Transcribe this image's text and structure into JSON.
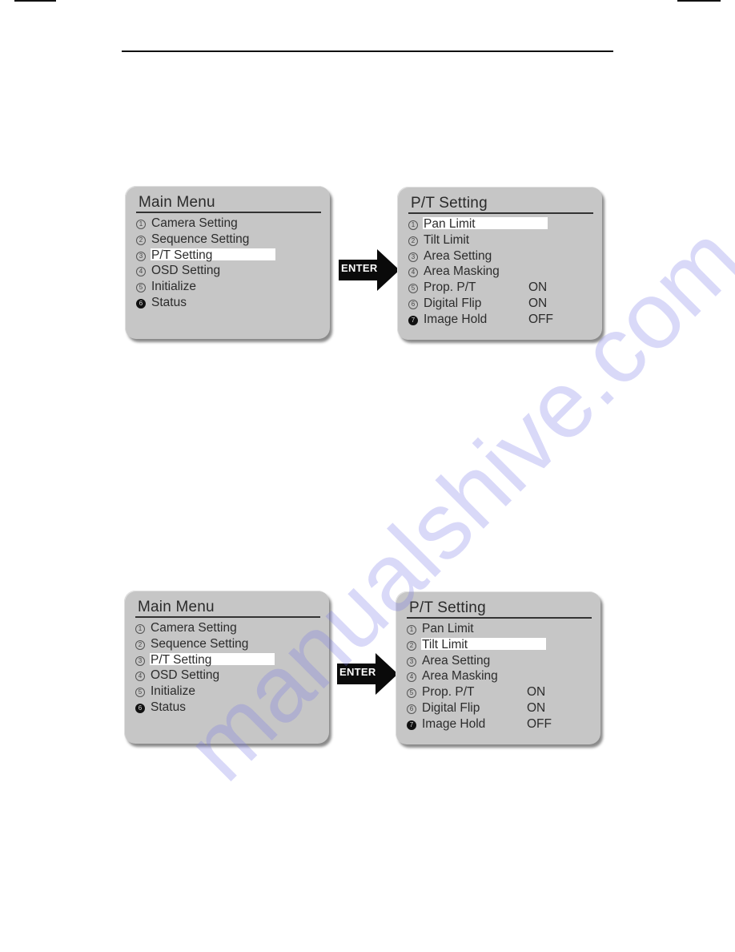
{
  "diagrams": [
    {
      "main_menu": {
        "title": "Main Menu",
        "items": [
          {
            "num": "1",
            "label": "Camera Setting",
            "filled": false
          },
          {
            "num": "2",
            "label": "Sequence Setting",
            "filled": false
          },
          {
            "num": "3",
            "label": "P/T Setting",
            "filled": false,
            "selected": true
          },
          {
            "num": "4",
            "label": "OSD Setting",
            "filled": false
          },
          {
            "num": "5",
            "label": "Initialize",
            "filled": false
          },
          {
            "num": "6",
            "label": "Status",
            "filled": true
          }
        ]
      },
      "arrow_label": "ENTER",
      "submenu": {
        "title": "P/T Setting",
        "items": [
          {
            "num": "1",
            "label": "Pan Limit",
            "value": "",
            "selected": true
          },
          {
            "num": "2",
            "label": "Tilt Limit",
            "value": ""
          },
          {
            "num": "3",
            "label": "Area Setting",
            "value": ""
          },
          {
            "num": "4",
            "label": "Area Masking",
            "value": ""
          },
          {
            "num": "5",
            "label": "Prop. P/T",
            "value": "ON"
          },
          {
            "num": "6",
            "label": "Digital Flip",
            "value": "ON"
          },
          {
            "num": "7",
            "label": "Image Hold",
            "value": "OFF",
            "filled": true
          }
        ]
      }
    },
    {
      "main_menu": {
        "title": "Main Menu",
        "items": [
          {
            "num": "1",
            "label": "Camera Setting",
            "filled": false
          },
          {
            "num": "2",
            "label": "Sequence Setting",
            "filled": false
          },
          {
            "num": "3",
            "label": "P/T Setting",
            "filled": false,
            "selected": true
          },
          {
            "num": "4",
            "label": "OSD Setting",
            "filled": false
          },
          {
            "num": "5",
            "label": "Initialize",
            "filled": false
          },
          {
            "num": "6",
            "label": "Status",
            "filled": true
          }
        ]
      },
      "arrow_label": "ENTER",
      "submenu": {
        "title": "P/T Setting",
        "items": [
          {
            "num": "1",
            "label": "Pan Limit",
            "value": ""
          },
          {
            "num": "2",
            "label": "Tilt Limit",
            "value": "",
            "selected": true
          },
          {
            "num": "3",
            "label": "Area Setting",
            "value": ""
          },
          {
            "num": "4",
            "label": "Area Masking",
            "value": ""
          },
          {
            "num": "5",
            "label": "Prop. P/T",
            "value": "ON"
          },
          {
            "num": "6",
            "label": "Digital Flip",
            "value": "ON"
          },
          {
            "num": "7",
            "label": "Image Hold",
            "value": "OFF",
            "filled": true
          }
        ]
      }
    }
  ],
  "watermark": "manualshive.com"
}
